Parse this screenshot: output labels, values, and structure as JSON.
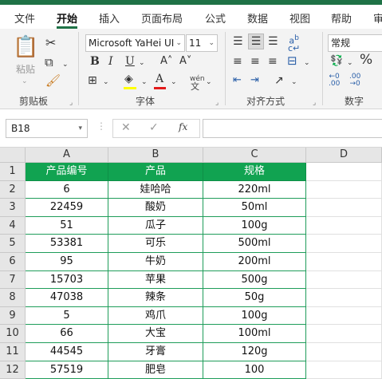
{
  "menu": {
    "tabs": [
      "文件",
      "开始",
      "插入",
      "页面布局",
      "公式",
      "数据",
      "视图",
      "帮助",
      "审"
    ],
    "active": "开始"
  },
  "ribbon": {
    "clipboard": {
      "paste_label": "粘贴",
      "group_label": "剪贴板"
    },
    "font": {
      "font_name": "Microsoft YaHei UI",
      "font_size": "11",
      "bold": "B",
      "italic": "I",
      "underline": "U",
      "grow": "A˄",
      "shrink": "A˅",
      "font_color_glyph": "A",
      "phonetic": "wén",
      "group_label": "字体",
      "highlight_color": "#ffff00",
      "font_color": "#e31b1b"
    },
    "alignment": {
      "group_label": "对齐方式"
    },
    "number": {
      "format": "常规",
      "percent": "%",
      "group_label": "数字"
    }
  },
  "formula_bar": {
    "name_box": "B18",
    "cancel": "✕",
    "confirm": "✓",
    "fx": "fx",
    "formula": ""
  },
  "sheet": {
    "columns": [
      "A",
      "B",
      "C",
      "D"
    ],
    "row_numbers": [
      "1",
      "2",
      "3",
      "4",
      "5",
      "6",
      "7",
      "8",
      "9",
      "10",
      "11",
      "12"
    ],
    "header_fill": "#11a351",
    "header": [
      "产品编号",
      "产品",
      "规格"
    ],
    "rows": [
      [
        "6",
        "娃哈哈",
        "220ml"
      ],
      [
        "22459",
        "酸奶",
        "50ml"
      ],
      [
        "51",
        "瓜子",
        "100g"
      ],
      [
        "53381",
        "可乐",
        "500ml"
      ],
      [
        "95",
        "牛奶",
        "200ml"
      ],
      [
        "15703",
        "苹果",
        "500g"
      ],
      [
        "47038",
        "辣条",
        "50g"
      ],
      [
        "5",
        "鸡爪",
        "100g"
      ],
      [
        "66",
        "大宝",
        "100ml"
      ],
      [
        "44545",
        "牙膏",
        "120g"
      ],
      [
        "57519",
        "肥皂",
        "100"
      ]
    ]
  }
}
